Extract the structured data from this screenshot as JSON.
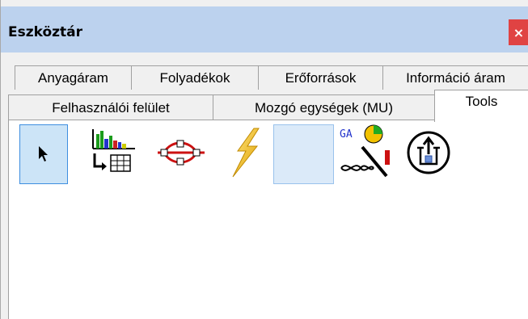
{
  "window": {
    "title": "Eszköztár",
    "close_label": "×"
  },
  "tabs": {
    "row1": [
      "Anyagáram",
      "Folyadékok",
      "Erőforrások",
      "Információ áram"
    ],
    "row2": [
      "Felhasználói felület",
      "Mozgó egységek (MU)",
      "Tools"
    ],
    "active": "Tools"
  },
  "tools": [
    {
      "icon": "pointer-arrow-icon",
      "selected": true
    },
    {
      "icon": "bar-chart-table-icon"
    },
    {
      "icon": "network-diagram-icon"
    },
    {
      "icon": "lightning-icon"
    },
    {
      "icon": "empty-slot"
    },
    {
      "icon": "genetic-algorithm-icon",
      "label": "GA"
    },
    {
      "icon": "upload-circle-icon"
    }
  ],
  "colors": {
    "titlebar": "#bcd2ee",
    "close": "#e04343",
    "selection": "#cce4f7"
  }
}
